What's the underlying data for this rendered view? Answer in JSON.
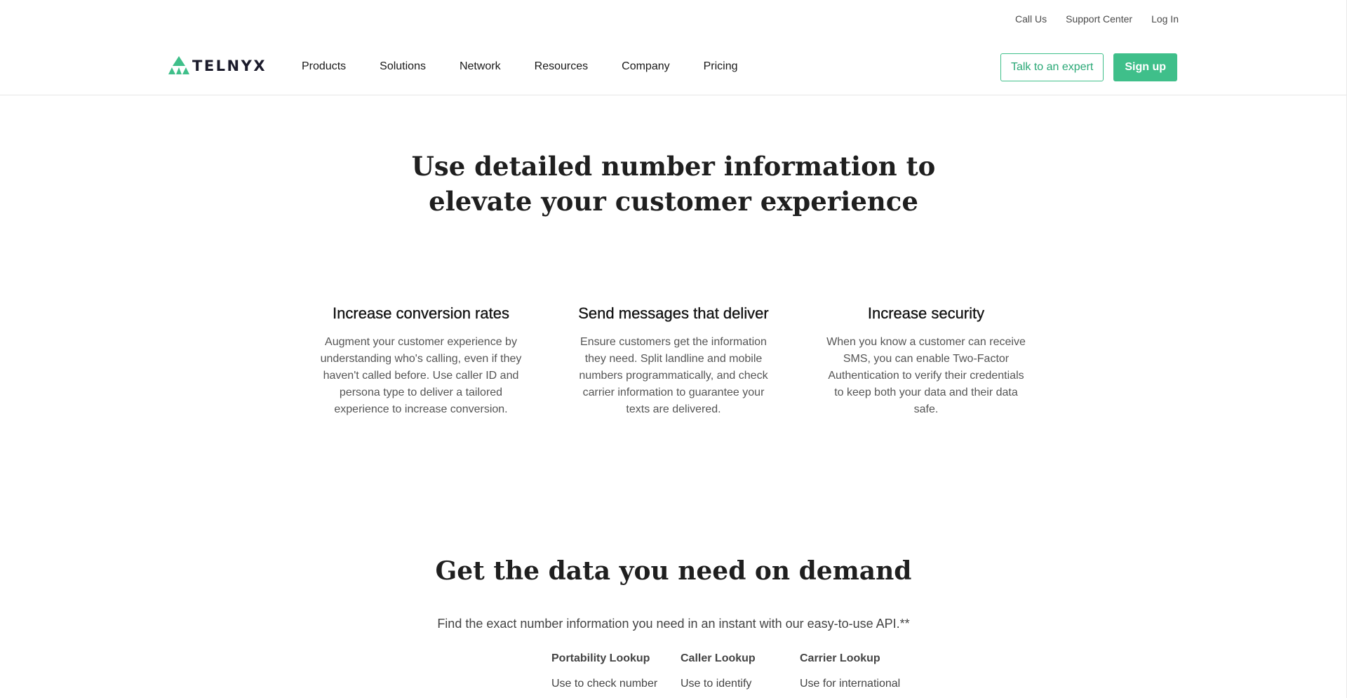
{
  "utility_links": {
    "call_us": "Call Us",
    "support_center": "Support Center",
    "log_in": "Log In"
  },
  "brand": {
    "name": "TELNYX",
    "accent_color": "#3fbf8a"
  },
  "nav": {
    "items": [
      {
        "label": "Products"
      },
      {
        "label": "Solutions"
      },
      {
        "label": "Network"
      },
      {
        "label": "Resources"
      },
      {
        "label": "Company"
      },
      {
        "label": "Pricing"
      }
    ]
  },
  "cta": {
    "talk_label": "Talk to an expert",
    "signup_label": "Sign up"
  },
  "hero": {
    "title_line1": "Use detailed number information to",
    "title_line2": "elevate your customer experience"
  },
  "features": [
    {
      "title": "Increase conversion rates",
      "body": "Augment your customer experience by understanding who's calling, even if they haven't called before. Use caller ID and persona type to deliver a tailored experience to increase conversion."
    },
    {
      "title": "Send messages that deliver",
      "body": "Ensure customers get the information they need. Split landline and mobile numbers programmatically, and check carrier information to guarantee your texts are delivered."
    },
    {
      "title": "Increase security",
      "body": "When you know a customer can receive SMS, you can enable Two-Factor Authentication to verify their credentials to keep both your data and their data safe."
    }
  ],
  "section2": {
    "title": "Get the data you need on demand",
    "subtitle": "Find the exact number information you need in an instant with our easy-to-use API.**",
    "lookups": [
      {
        "title": "Portability Lookup",
        "desc": "Use to check number"
      },
      {
        "title": "Caller Lookup",
        "desc": "Use to identify"
      },
      {
        "title": "Carrier Lookup",
        "desc": "Use for international"
      }
    ]
  }
}
